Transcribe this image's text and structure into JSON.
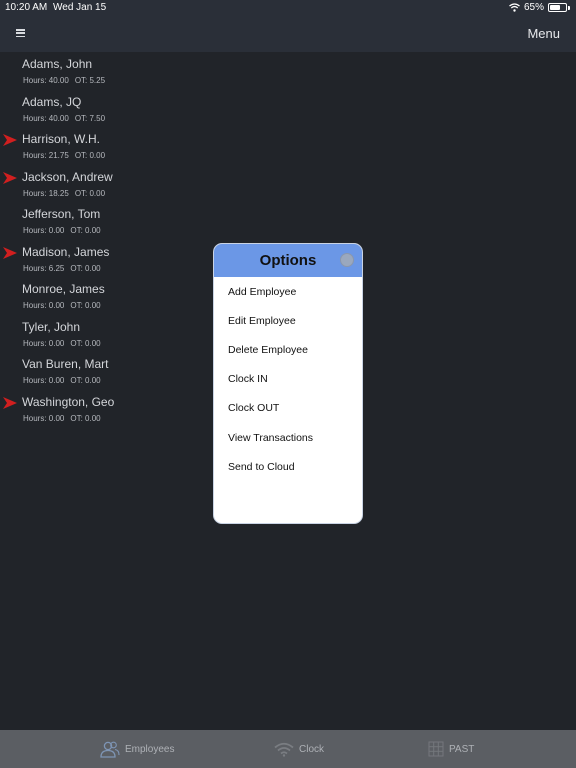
{
  "status_bar": {
    "time": "10:20 AM",
    "date": "Wed Jan 15",
    "battery_text": "65%",
    "battery_level": 0.65,
    "icons": [
      "wifi-icon",
      "battery-icon"
    ]
  },
  "nav": {
    "menu_icon": "hamburger-icon",
    "menu_label": "Menu"
  },
  "employees": [
    {
      "name": "Adams, John",
      "hours": "Hours: 40.00",
      "ot": "OT: 5.25",
      "flagged": false
    },
    {
      "name": "Adams, JQ",
      "hours": "Hours: 40.00",
      "ot": "OT: 7.50",
      "flagged": false
    },
    {
      "name": "Harrison, W.H.",
      "hours": "Hours: 21.75",
      "ot": "OT: 0.00",
      "flagged": true
    },
    {
      "name": "Jackson, Andrew",
      "hours": "Hours: 18.25",
      "ot": "OT: 0.00",
      "flagged": true
    },
    {
      "name": "Jefferson, Tom",
      "hours": "Hours: 0.00",
      "ot": "OT: 0.00",
      "flagged": false
    },
    {
      "name": "Madison, James",
      "hours": "Hours: 6.25",
      "ot": "OT: 0.00",
      "flagged": true
    },
    {
      "name": "Monroe, James",
      "hours": "Hours: 0.00",
      "ot": "OT: 0.00",
      "flagged": false
    },
    {
      "name": "Tyler, John",
      "hours": "Hours: 0.00",
      "ot": "OT: 0.00",
      "flagged": false
    },
    {
      "name": "Van Buren, Mart",
      "hours": "Hours: 0.00",
      "ot": "OT: 0.00",
      "flagged": false
    },
    {
      "name": "Washington, Geo",
      "hours": "Hours: 0.00",
      "ot": "OT: 0.00",
      "flagged": true
    }
  ],
  "options_dialog": {
    "title": "Options",
    "items": [
      "Add Employee",
      "Edit Employee",
      "Delete Employee",
      "Clock IN",
      "Clock OUT",
      "View Transactions",
      "Send to Cloud"
    ]
  },
  "tabs": [
    {
      "label": "Employees",
      "icon": "people-icon"
    },
    {
      "label": "Clock",
      "icon": "wifi-icon"
    },
    {
      "label": "PAST",
      "icon": "grid-icon"
    }
  ],
  "colors": {
    "background": "#212429",
    "navbar": "#2a2f38",
    "dialog_header": "#6b97e6",
    "flag_arrow": "#d11f1f",
    "tabbar": "#5b5e63"
  }
}
